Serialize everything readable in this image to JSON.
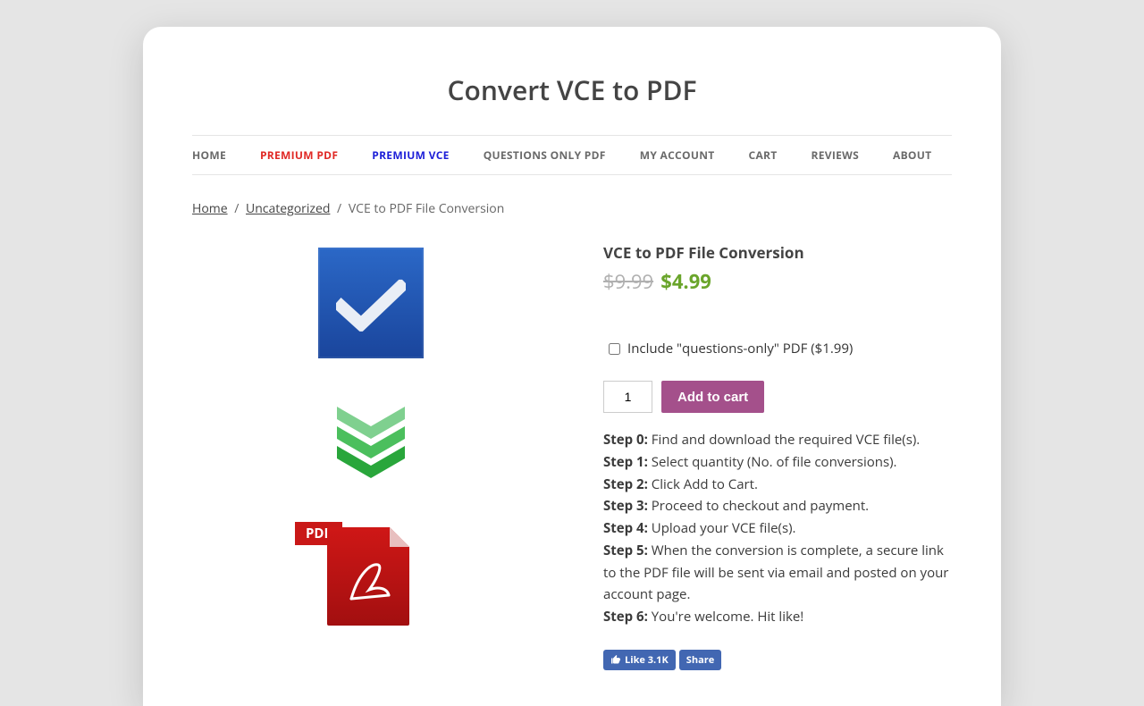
{
  "site": {
    "title": "Convert VCE to PDF"
  },
  "nav": {
    "items": [
      {
        "label": "HOME"
      },
      {
        "label": "PREMIUM PDF"
      },
      {
        "label": "PREMIUM VCE"
      },
      {
        "label": "QUESTIONS ONLY PDF"
      },
      {
        "label": "MY ACCOUNT"
      },
      {
        "label": "CART"
      },
      {
        "label": "REVIEWS"
      },
      {
        "label": "ABOUT"
      }
    ]
  },
  "breadcrumb": {
    "home": "Home",
    "category": "Uncategorized",
    "current": "VCE to PDF File Conversion"
  },
  "product": {
    "title": "VCE to PDF File Conversion",
    "price_old": "$9.99",
    "price_new": "$4.99",
    "addon_label": "Include \"questions-only\" PDF ($1.99)",
    "quantity": "1",
    "add_button": "Add to cart"
  },
  "steps": [
    {
      "label": "Step 0:",
      "text": " Find and download the required VCE file(s)."
    },
    {
      "label": "Step 1:",
      "text": " Select quantity (No. of file conversions)."
    },
    {
      "label": "Step 2:",
      "text": " Click Add to Cart."
    },
    {
      "label": "Step 3:",
      "text": " Proceed to checkout and payment."
    },
    {
      "label": "Step 4:",
      "text": " Upload your VCE file(s)."
    },
    {
      "label": "Step 5:",
      "text": " When the conversion is complete, a secure link to the PDF file will be sent via email and posted on your account page."
    },
    {
      "label": "Step 6:",
      "text": " You're welcome. Hit like!"
    }
  ],
  "fb": {
    "like": "Like 3.1K",
    "share": "Share"
  },
  "pdf_badge": "PDF"
}
